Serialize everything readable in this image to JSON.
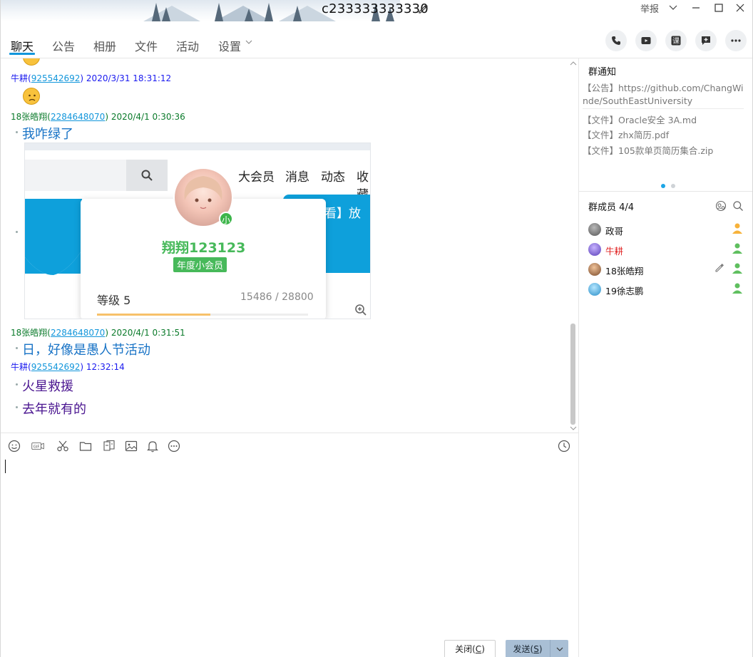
{
  "window": {
    "title": "c233333333330",
    "report_label": "举报"
  },
  "tabs": [
    {
      "label": "聊天"
    },
    {
      "label": "公告"
    },
    {
      "label": "相册"
    },
    {
      "label": "文件"
    },
    {
      "label": "活动"
    },
    {
      "label": "设置"
    }
  ],
  "toolbar_right": [
    "phone-icon",
    "video-icon",
    "class-icon",
    "add-app-icon",
    "more-icon"
  ],
  "messages": [
    {
      "sender": "牛耕",
      "qq": "925542692",
      "time": "2020/3/31 18:31:12",
      "type": "emoji"
    },
    {
      "sender": "18张皓翔",
      "qq": "2284648070",
      "time": "2020/4/1 0:30:36",
      "text": "我咋绿了"
    },
    {
      "sender": "18张皓翔",
      "qq": "2284648070",
      "time": "2020/4/1 0:31:51",
      "text": "日，好像是愚人节活动"
    },
    {
      "sender": "牛耕",
      "qq": "925542692",
      "time": "12:32:14",
      "texts": [
        "火星救援",
        "去年就有的"
      ]
    }
  ],
  "screenshot": {
    "nav": [
      "大会员",
      "消息",
      "动态",
      "收藏"
    ],
    "banner_text": "【再看】放",
    "username": "翔翔123123",
    "badge": "年度小会员",
    "vip_mark": "小",
    "level_label": "等级 5",
    "progress_text": "15486 / 28800",
    "progress_fraction": 0.5376
  },
  "compose": {
    "close_label": "关闭(C)",
    "close_base": "关闭(",
    "close_key": "C",
    "send_base": "发送(",
    "send_key": "S",
    "paren_close": ")"
  },
  "notice": {
    "title": "群通知",
    "lines": [
      "【公告】https://github.com/ChangWi",
      "nde/SouthEastUniversity",
      "【文件】Oracle安全 3A.md",
      "【文件】zhx简历.pdf",
      "【文件】105款单页简历集合.zip"
    ]
  },
  "members": {
    "title": "群成员 4/4",
    "list": [
      {
        "name": "政哥",
        "role": "owner"
      },
      {
        "name": "牛耕",
        "role": "member",
        "color": "#e02020"
      },
      {
        "name": "18张皓翔",
        "role": "member"
      },
      {
        "name": "19徐志鹏",
        "role": "member"
      }
    ]
  },
  "colors": {
    "accent": "#1296db",
    "send_button": "#a9bfd5",
    "sender_blue": "#1a1aef",
    "sender_green": "#0a7a2a"
  }
}
